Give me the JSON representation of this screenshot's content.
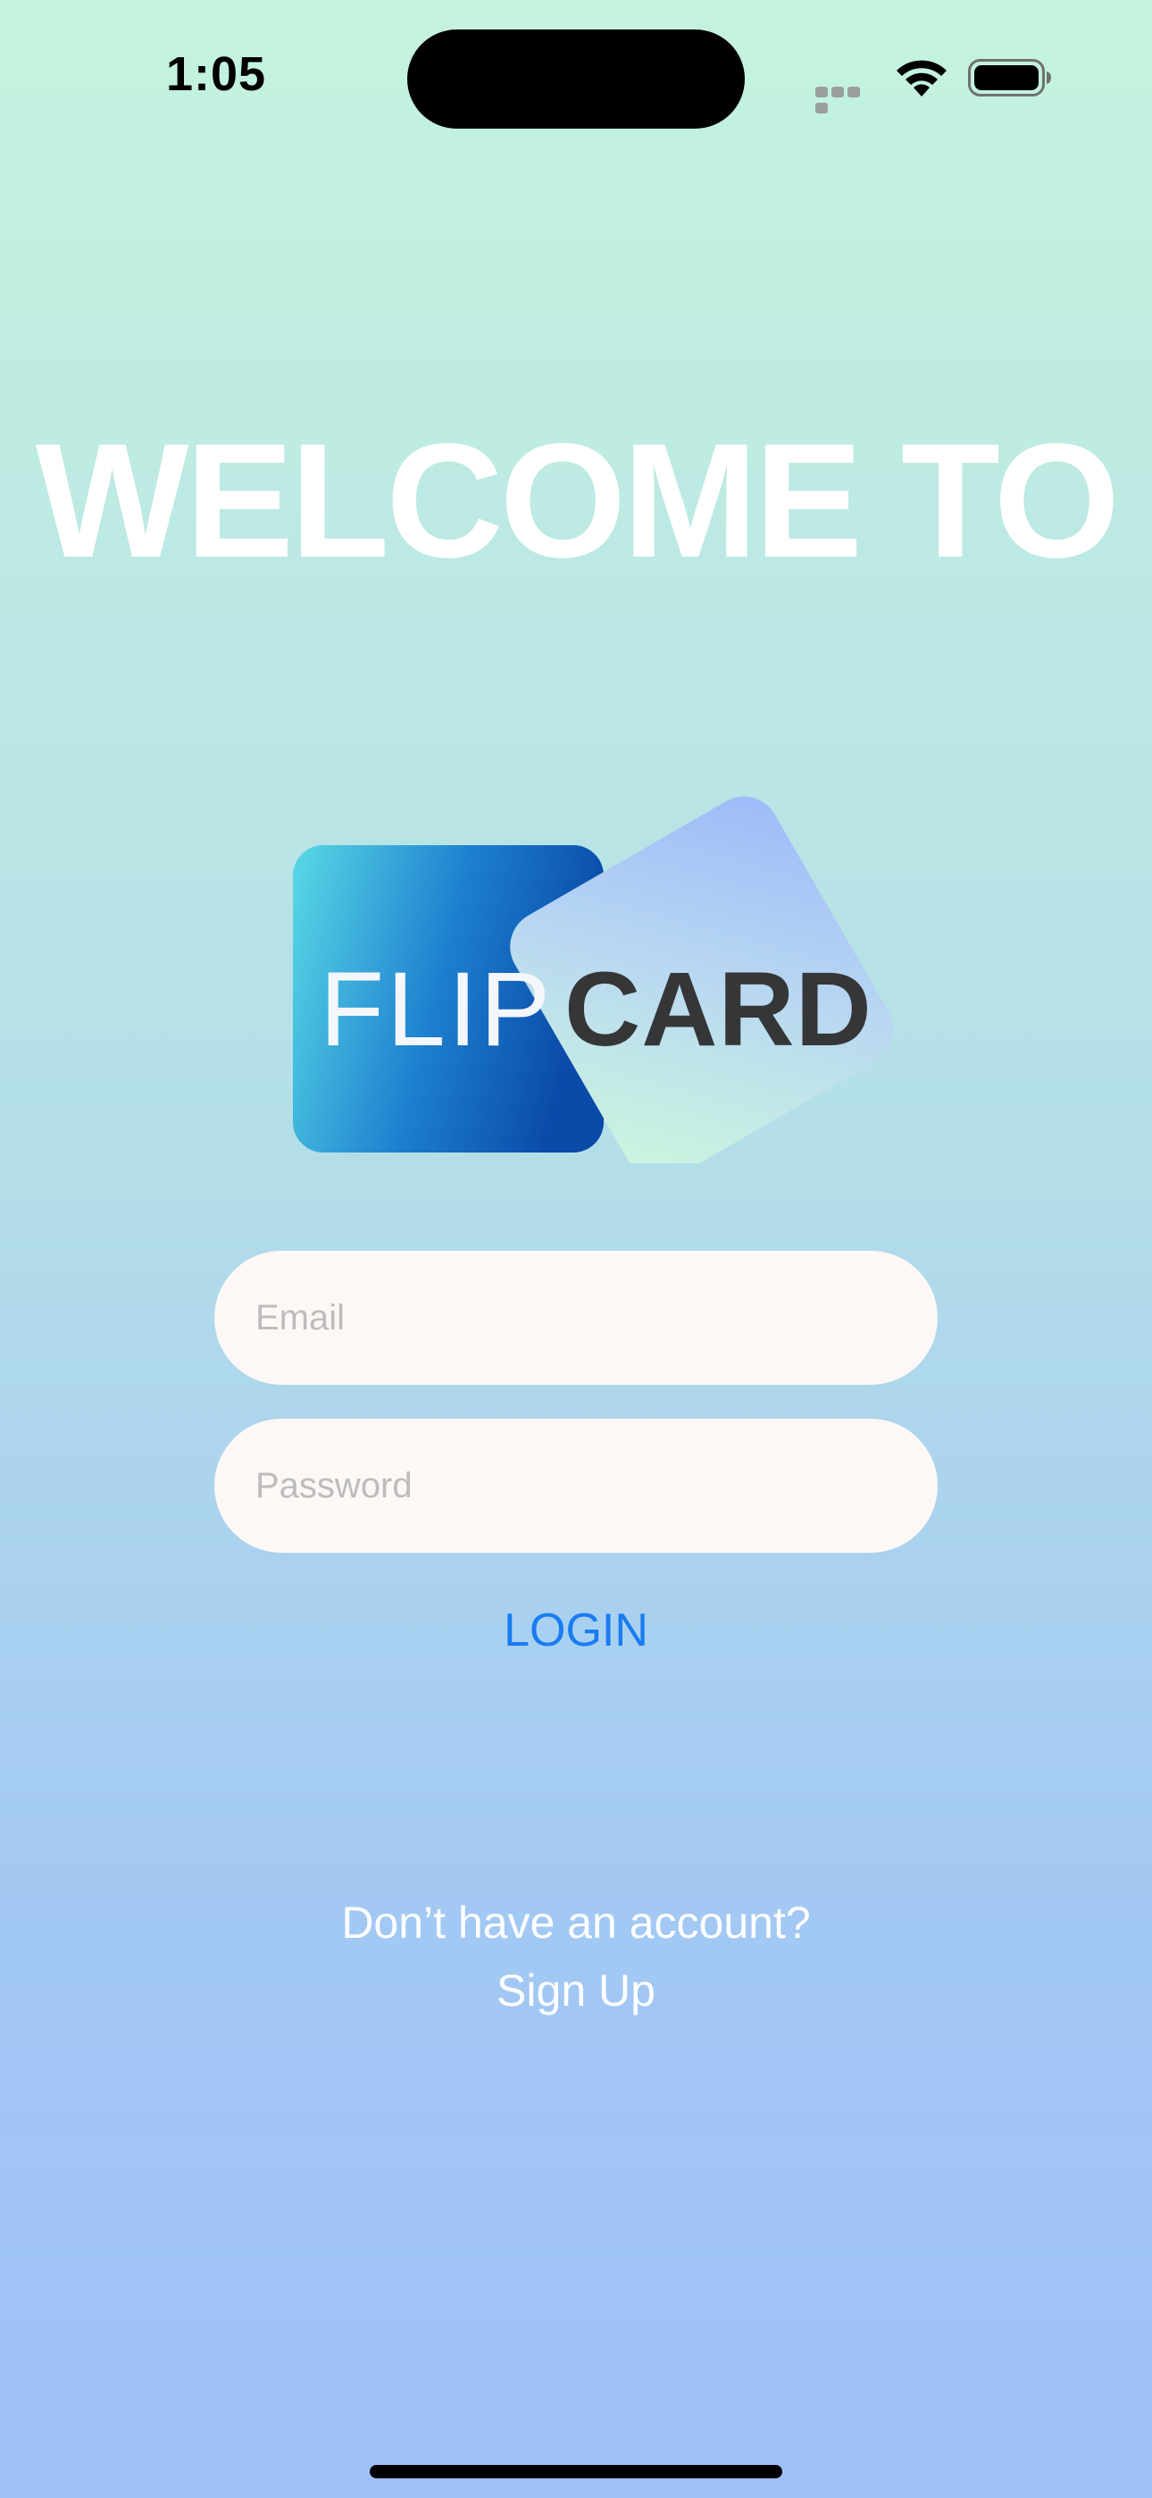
{
  "status_bar": {
    "time": "1:05",
    "icons": [
      "cellular-signal-icon",
      "wifi-icon",
      "battery-icon"
    ]
  },
  "header": {
    "title": "WELCOME TO"
  },
  "logo": {
    "left_text": "FLIP",
    "right_text": "CARD",
    "icon": "flipcard-logo",
    "colors": {
      "left_card_start": "#56d6e6",
      "left_card_end": "#0a4fb0",
      "right_card_start": "#c9f7df",
      "right_card_end": "#9bbdf9",
      "left_text": "#f3f7fb",
      "right_text": "#343638"
    }
  },
  "form": {
    "email": {
      "value": "",
      "placeholder": "Email"
    },
    "password": {
      "value": "",
      "placeholder": "Password"
    },
    "login_label": "LOGIN"
  },
  "footer": {
    "prompt": "Don’t have an account?",
    "signup_label": "Sign Up"
  },
  "colors": {
    "background_top": "#c4f3de",
    "background_bottom": "#9dc0f9",
    "accent": "#1a7cf1",
    "input_background": "#fdf8f6"
  }
}
